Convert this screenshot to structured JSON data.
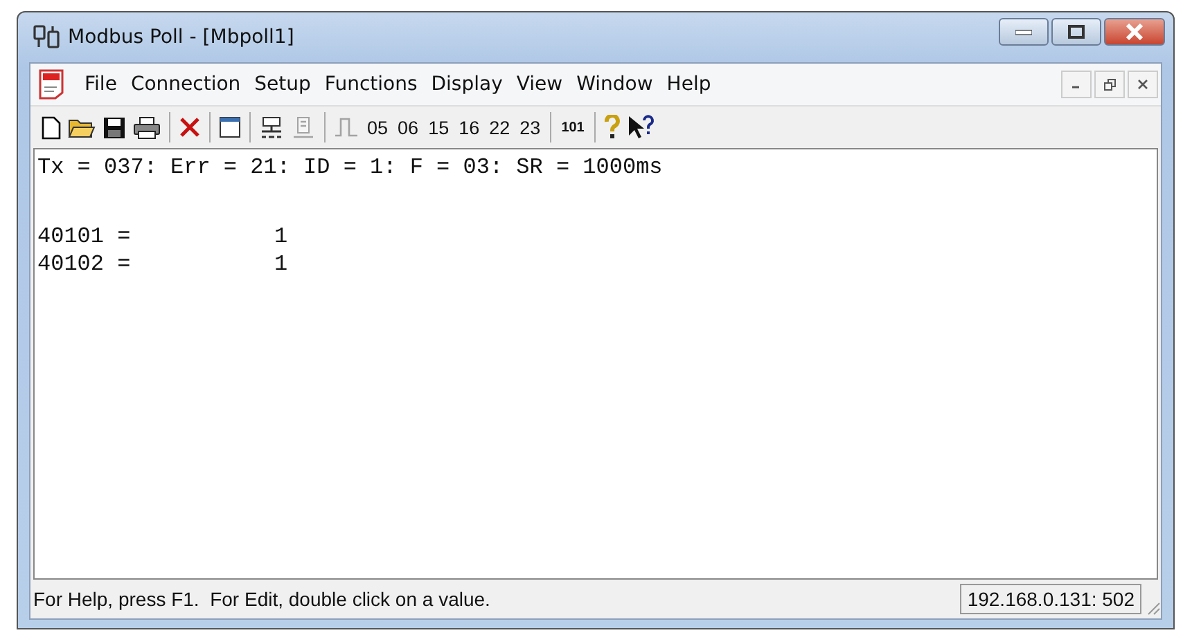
{
  "window": {
    "title": "Modbus Poll - [Mbpoll1]"
  },
  "menu": [
    {
      "label": "File"
    },
    {
      "label": "Connection"
    },
    {
      "label": "Setup"
    },
    {
      "label": "Functions"
    },
    {
      "label": "Display"
    },
    {
      "label": "View"
    },
    {
      "label": "Window"
    },
    {
      "label": "Help"
    }
  ],
  "toolbar": [
    {
      "kind": "icon",
      "disabled": false
    },
    {
      "kind": "icon",
      "disabled": false
    },
    {
      "kind": "icon",
      "disabled": false
    },
    {
      "kind": "icon",
      "disabled": false
    },
    {
      "kind": "sep"
    },
    {
      "kind": "icon",
      "disabled": false
    },
    {
      "kind": "sep"
    },
    {
      "kind": "icon",
      "disabled": false
    },
    {
      "kind": "sep"
    },
    {
      "kind": "icon",
      "disabled": false
    },
    {
      "kind": "icon",
      "disabled": true
    },
    {
      "kind": "sep"
    },
    {
      "kind": "icon",
      "disabled": true
    },
    {
      "kind": "text",
      "label": "05"
    },
    {
      "kind": "text",
      "label": "06"
    },
    {
      "kind": "text",
      "label": "15"
    },
    {
      "kind": "text",
      "label": "16"
    },
    {
      "kind": "text",
      "label": "22"
    },
    {
      "kind": "text",
      "label": "23"
    },
    {
      "kind": "sep"
    },
    {
      "kind": "small",
      "label": "101"
    },
    {
      "kind": "sep"
    },
    {
      "kind": "icon",
      "disabled": false
    },
    {
      "kind": "icon",
      "disabled": false
    }
  ],
  "content": {
    "header": "Tx = 037: Err = 21: ID = 1: F = 03: SR = 1000ms",
    "registers": [
      {
        "address": "40101 =",
        "value": "1"
      },
      {
        "address": "40102 =",
        "value": "1"
      }
    ]
  },
  "status_bar": {
    "message": "For Help, press F1.  For Edit, double click on a value.",
    "connection": "192.168.0.131: 502"
  }
}
